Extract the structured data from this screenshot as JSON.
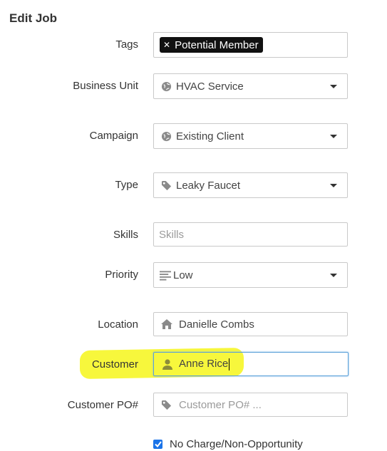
{
  "page": {
    "title": "Edit Job"
  },
  "fields": {
    "tags": {
      "label": "Tags",
      "tag_value": "Potential Member"
    },
    "business_unit": {
      "label": "Business Unit",
      "value": "HVAC Service"
    },
    "campaign": {
      "label": "Campaign",
      "value": "Existing Client"
    },
    "type": {
      "label": "Type",
      "value": "Leaky Faucet"
    },
    "skills": {
      "label": "Skills",
      "placeholder": "Skills"
    },
    "priority": {
      "label": "Priority",
      "value": "Low"
    },
    "location": {
      "label": "Location",
      "value": "Danielle Combs"
    },
    "customer": {
      "label": "Customer",
      "value": "Anne Rice"
    },
    "customer_po": {
      "label": "Customer PO#",
      "placeholder": "Customer PO# ..."
    }
  },
  "no_charge": {
    "label": "No Charge/Non-Opportunity",
    "checked": true
  },
  "colors": {
    "highlight": "#f7f73c",
    "checkbox": "#1a73e8",
    "focus_border": "#5aa0d8"
  },
  "icons": {
    "business_unit": "globe-icon",
    "campaign": "globe-icon",
    "type": "tag-icon",
    "priority": "priority-bars-icon",
    "location": "home-icon",
    "customer": "person-icon",
    "customer_po": "tag-icon"
  }
}
